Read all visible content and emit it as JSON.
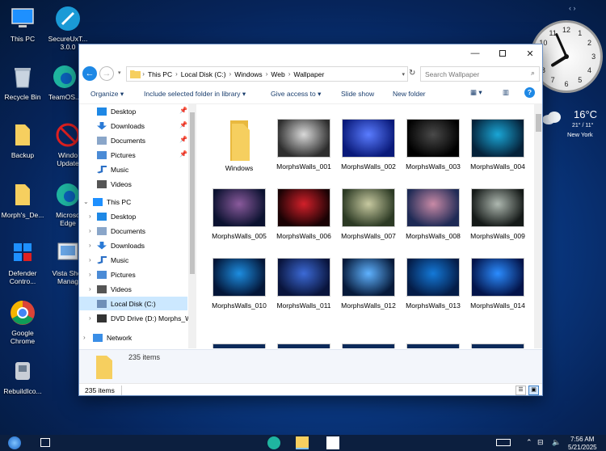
{
  "desktop": {
    "icons": [
      {
        "label": "This PC"
      },
      {
        "label": "SecureUxT...",
        "label2": "3.0.0"
      },
      {
        "label": "Recycle Bin"
      },
      {
        "label": "TeamOS..."
      },
      {
        "label": "Backup"
      },
      {
        "label": "Windo",
        "label2": "Update"
      },
      {
        "label": "Morph's_De..."
      },
      {
        "label": "Microso",
        "label2": "Edge"
      },
      {
        "label": "Defender",
        "label2": "Contro..."
      },
      {
        "label": "Vista Shor",
        "label2": "Manag"
      },
      {
        "label": "Google",
        "label2": "Chrome"
      },
      {
        "label": "RebuildIco..."
      }
    ]
  },
  "explorer": {
    "address": {
      "segments": [
        "This PC",
        "Local Disk (C:)",
        "Windows",
        "Web",
        "Wallpaper"
      ]
    },
    "search": {
      "placeholder": "Search Wallpaper"
    },
    "commands": {
      "organize": "Organize ▾",
      "include": "Include selected folder in library ▾",
      "give_access": "Give access to ▾",
      "slide_show": "Slide show",
      "new_folder": "New folder"
    },
    "nav": {
      "quick": [
        "Desktop",
        "Downloads",
        "Documents",
        "Pictures",
        "Music",
        "Videos"
      ],
      "this_pc": "This PC",
      "pc_items": [
        "Desktop",
        "Documents",
        "Downloads",
        "Music",
        "Pictures",
        "Videos",
        "Local Disk (C:)",
        "DVD Drive (D:) Morphs_W"
      ],
      "network": "Network"
    },
    "items": [
      {
        "name": "Windows",
        "type": "folder"
      },
      {
        "name": "MorphsWalls_001",
        "c1": "#d9d9d9",
        "c2": "#2e2e2e"
      },
      {
        "name": "MorphsWalls_002",
        "c1": "#5a7cff",
        "c2": "#0a1a7a"
      },
      {
        "name": "MorphsWalls_003",
        "c1": "#4a4a4a",
        "c2": "#000000"
      },
      {
        "name": "MorphsWalls_004",
        "c1": "#1aa6d6",
        "c2": "#05223a"
      },
      {
        "name": "MorphsWalls_005",
        "c1": "#8a5a9c",
        "c2": "#0b1230"
      },
      {
        "name": "MorphsWalls_006",
        "c1": "#d2202a",
        "c2": "#1a0204"
      },
      {
        "name": "MorphsWalls_007",
        "c1": "#c7c9a0",
        "c2": "#2c3a24"
      },
      {
        "name": "MorphsWalls_008",
        "c1": "#c98aa6",
        "c2": "#1e2a55"
      },
      {
        "name": "MorphsWalls_009",
        "c1": "#aeb8b0",
        "c2": "#151a18"
      },
      {
        "name": "MorphsWalls_010",
        "c1": "#1d8de0",
        "c2": "#031638"
      },
      {
        "name": "MorphsWalls_011",
        "c1": "#3c6ad6",
        "c2": "#09143c"
      },
      {
        "name": "MorphsWalls_012",
        "c1": "#5fb2ff",
        "c2": "#061a3a"
      },
      {
        "name": "MorphsWalls_013",
        "c1": "#1479d8",
        "c2": "#041c47"
      },
      {
        "name": "MorphsWalls_014",
        "c1": "#2b8cff",
        "c2": "#03144a"
      }
    ],
    "details": {
      "count": "235 items"
    },
    "status": {
      "count": "235 items"
    }
  },
  "widgets": {
    "clock": {
      "hour": 7,
      "minute": 56
    },
    "weather": {
      "temp": "16°C",
      "range": "21° / 11°",
      "city": "New York"
    }
  },
  "taskbar": {
    "time": "7:56 AM",
    "date": "5/21/2025"
  },
  "colors": {
    "accent": "#0078d7",
    "selected": "#cce8ff",
    "folder": "#f6cf5f"
  }
}
